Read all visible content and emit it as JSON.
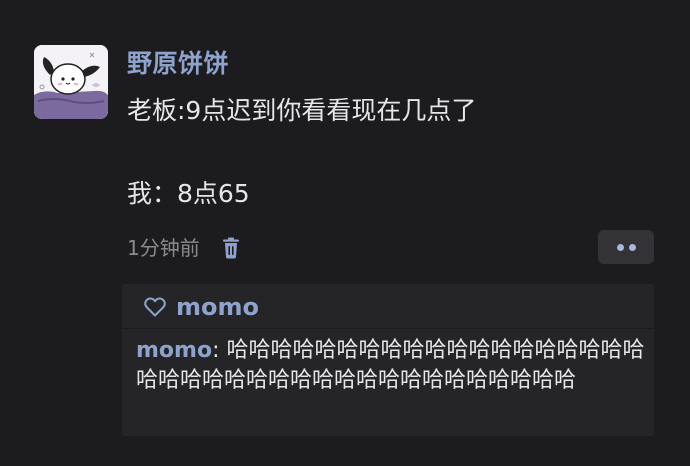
{
  "post": {
    "author": "野原饼饼",
    "avatar_icon": "pochacco-avatar-icon",
    "lines": [
      "老板:9点迟到你看看现在几点了",
      "",
      "我：8点65"
    ],
    "time": "1分钟前",
    "delete_icon": "trash-icon",
    "more_icon": "more-dots-icon"
  },
  "comments": {
    "like_icon": "heart-outline-icon",
    "liked_by": "momo",
    "items": [
      {
        "author": "momo",
        "separator": ": ",
        "text": "哈哈哈哈哈哈哈哈哈哈哈哈哈哈哈哈哈哈哈哈哈哈哈哈哈哈哈哈哈哈哈哈哈哈哈哈哈哈哈"
      }
    ]
  },
  "colors": {
    "background": "#1c1c1e",
    "name_link": "#8ea2cc",
    "body_text": "#e6e6e8",
    "muted_text": "#8a8a8f",
    "comment_panel": "#252527"
  }
}
